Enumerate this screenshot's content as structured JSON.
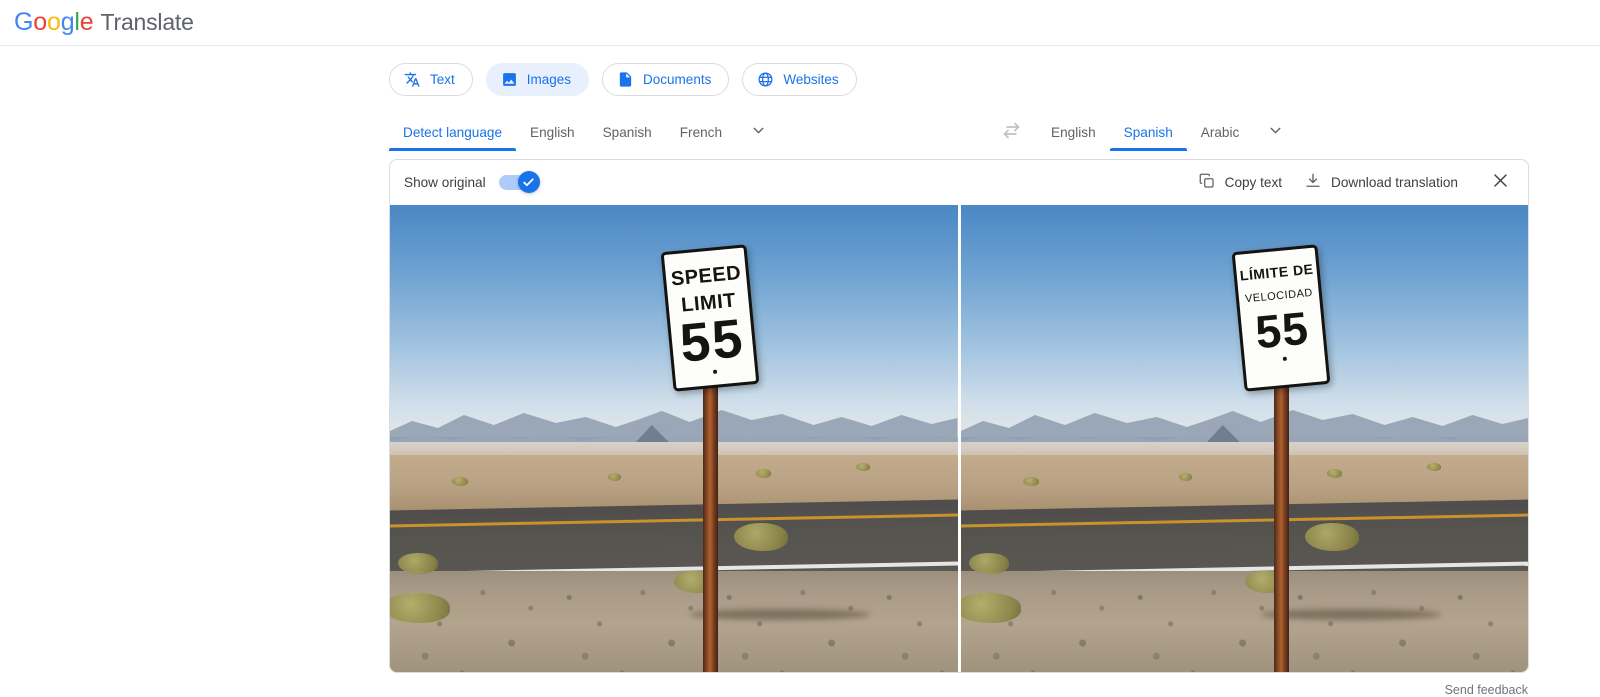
{
  "header": {
    "logo_word": "Google",
    "product": "Translate",
    "logo_letters": [
      "G",
      "o",
      "o",
      "g",
      "l",
      "e"
    ]
  },
  "tabs": [
    {
      "label": "Text",
      "icon": "translate-icon",
      "active": false
    },
    {
      "label": "Images",
      "icon": "image-icon",
      "active": true
    },
    {
      "label": "Documents",
      "icon": "document-icon",
      "active": false
    },
    {
      "label": "Websites",
      "icon": "globe-icon",
      "active": false
    }
  ],
  "source_languages": {
    "items": [
      {
        "label": "Detect language",
        "selected": true
      },
      {
        "label": "English",
        "selected": false
      },
      {
        "label": "Spanish",
        "selected": false
      },
      {
        "label": "French",
        "selected": false
      }
    ],
    "more_icon": "chevron-down-icon"
  },
  "swap": {
    "icon": "swap-horizontal-icon"
  },
  "target_languages": {
    "items": [
      {
        "label": "English",
        "selected": false
      },
      {
        "label": "Spanish",
        "selected": true
      },
      {
        "label": "Arabic",
        "selected": false
      }
    ],
    "more_icon": "chevron-down-icon"
  },
  "toolbar": {
    "show_original_label": "Show original",
    "show_original_on": true,
    "copy_text_label": "Copy text",
    "copy_icon": "copy-icon",
    "download_label": "Download translation",
    "download_icon": "download-icon",
    "close_icon": "close-icon"
  },
  "images": {
    "original": {
      "alt": "Desert highway speed limit sign, original",
      "sign_line1": "SPEED",
      "sign_line2": "LIMIT",
      "sign_number": "55"
    },
    "translated": {
      "alt": "Desert highway speed limit sign, translated to Spanish",
      "sign_line1": "LÍMITE DE",
      "sign_line2": "VELOCIDAD",
      "sign_number": "55"
    }
  },
  "footer": {
    "label": "Send feedback"
  },
  "colors": {
    "accent": "#1a73e8",
    "accent_soft": "#e8f0fe",
    "toggle_track": "#aecbfa",
    "text_primary": "#3c4043",
    "text_secondary": "#5f6368",
    "border": "#dadce0"
  }
}
